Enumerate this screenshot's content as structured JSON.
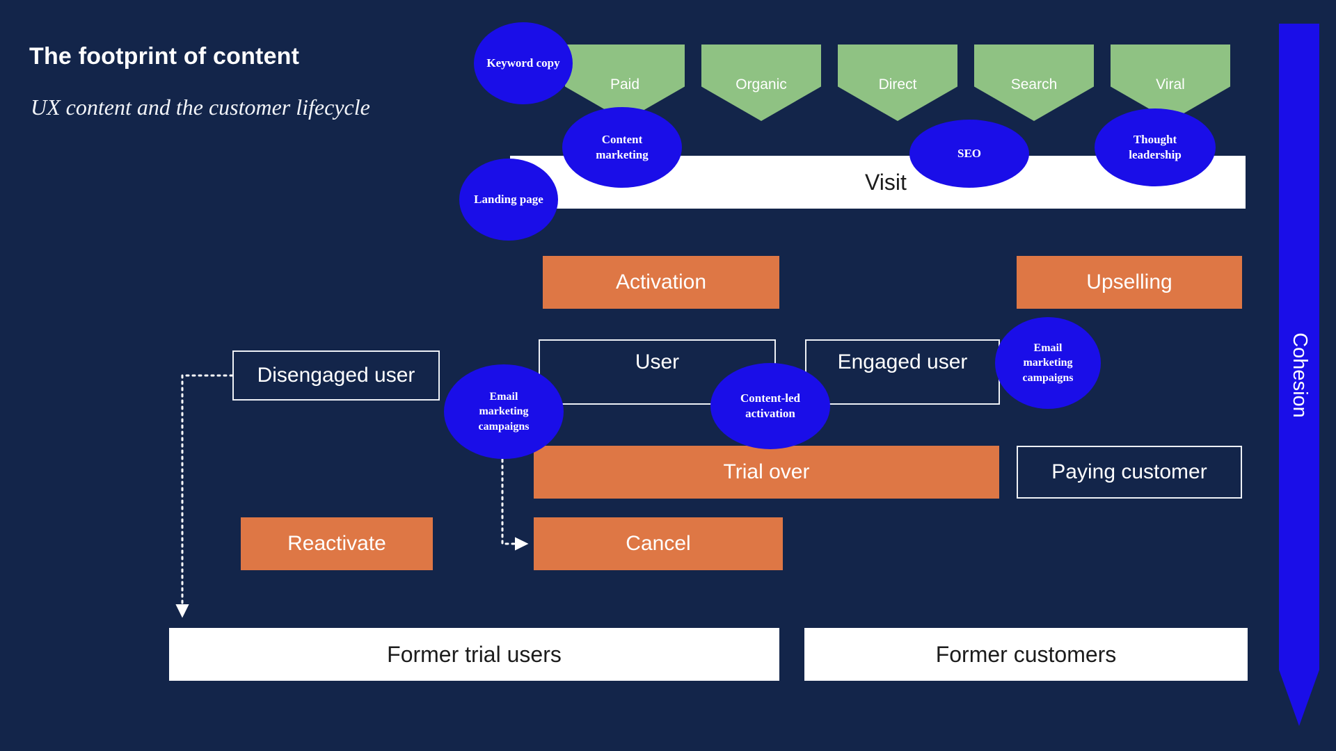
{
  "heading": {
    "title": "The footprint of content",
    "subtitle": "UX content and the customer lifecycle"
  },
  "channels": [
    {
      "label": "Paid"
    },
    {
      "label": "Organic"
    },
    {
      "label": "Direct"
    },
    {
      "label": "Search"
    },
    {
      "label": "Viral"
    }
  ],
  "stages": {
    "visit": "Visit",
    "activation": "Activation",
    "upselling": "Upselling",
    "disengaged_user": "Disengaged user",
    "user": "User",
    "engaged_user": "Engaged user",
    "trial_over": "Trial over",
    "paying_customer": "Paying customer",
    "reactivate": "Reactivate",
    "cancel": "Cancel",
    "former_trial_users": "Former trial users",
    "former_customers": "Former customers"
  },
  "content_bubbles": {
    "keyword_copy": "Keyword copy",
    "content_marketing": "Content\nmarketing",
    "landing_page": "Landing page",
    "seo": "SEO",
    "thought_leadership": "Thought\nleadership",
    "email_marketing_left": "Email\nmarketing\ncampaigns",
    "content_led_activation": "Content-led\nactivation",
    "email_marketing_right": "Email\nmarketing\ncampaigns"
  },
  "sidebar": {
    "cohesion": "Cohesion"
  },
  "colors": {
    "background": "#13254a",
    "channel_green": "#8fc283",
    "bubble_blue": "#1a0ee8",
    "stage_orange": "#de7745",
    "bar_white": "#ffffff",
    "text_white": "#ffffff"
  }
}
